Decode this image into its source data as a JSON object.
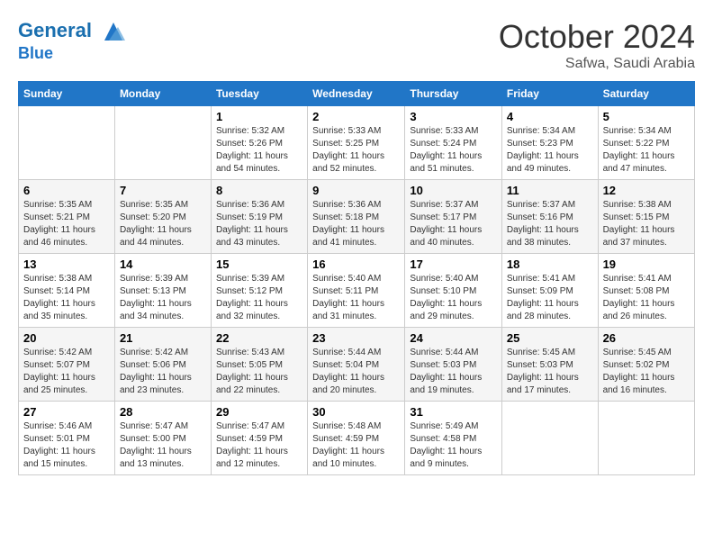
{
  "header": {
    "logo_line1": "General",
    "logo_line2": "Blue",
    "month": "October 2024",
    "location": "Safwa, Saudi Arabia"
  },
  "weekdays": [
    "Sunday",
    "Monday",
    "Tuesday",
    "Wednesday",
    "Thursday",
    "Friday",
    "Saturday"
  ],
  "weeks": [
    [
      {
        "day": "",
        "sunrise": "",
        "sunset": "",
        "daylight": ""
      },
      {
        "day": "",
        "sunrise": "",
        "sunset": "",
        "daylight": ""
      },
      {
        "day": "1",
        "sunrise": "Sunrise: 5:32 AM",
        "sunset": "Sunset: 5:26 PM",
        "daylight": "Daylight: 11 hours and 54 minutes."
      },
      {
        "day": "2",
        "sunrise": "Sunrise: 5:33 AM",
        "sunset": "Sunset: 5:25 PM",
        "daylight": "Daylight: 11 hours and 52 minutes."
      },
      {
        "day": "3",
        "sunrise": "Sunrise: 5:33 AM",
        "sunset": "Sunset: 5:24 PM",
        "daylight": "Daylight: 11 hours and 51 minutes."
      },
      {
        "day": "4",
        "sunrise": "Sunrise: 5:34 AM",
        "sunset": "Sunset: 5:23 PM",
        "daylight": "Daylight: 11 hours and 49 minutes."
      },
      {
        "day": "5",
        "sunrise": "Sunrise: 5:34 AM",
        "sunset": "Sunset: 5:22 PM",
        "daylight": "Daylight: 11 hours and 47 minutes."
      }
    ],
    [
      {
        "day": "6",
        "sunrise": "Sunrise: 5:35 AM",
        "sunset": "Sunset: 5:21 PM",
        "daylight": "Daylight: 11 hours and 46 minutes."
      },
      {
        "day": "7",
        "sunrise": "Sunrise: 5:35 AM",
        "sunset": "Sunset: 5:20 PM",
        "daylight": "Daylight: 11 hours and 44 minutes."
      },
      {
        "day": "8",
        "sunrise": "Sunrise: 5:36 AM",
        "sunset": "Sunset: 5:19 PM",
        "daylight": "Daylight: 11 hours and 43 minutes."
      },
      {
        "day": "9",
        "sunrise": "Sunrise: 5:36 AM",
        "sunset": "Sunset: 5:18 PM",
        "daylight": "Daylight: 11 hours and 41 minutes."
      },
      {
        "day": "10",
        "sunrise": "Sunrise: 5:37 AM",
        "sunset": "Sunset: 5:17 PM",
        "daylight": "Daylight: 11 hours and 40 minutes."
      },
      {
        "day": "11",
        "sunrise": "Sunrise: 5:37 AM",
        "sunset": "Sunset: 5:16 PM",
        "daylight": "Daylight: 11 hours and 38 minutes."
      },
      {
        "day": "12",
        "sunrise": "Sunrise: 5:38 AM",
        "sunset": "Sunset: 5:15 PM",
        "daylight": "Daylight: 11 hours and 37 minutes."
      }
    ],
    [
      {
        "day": "13",
        "sunrise": "Sunrise: 5:38 AM",
        "sunset": "Sunset: 5:14 PM",
        "daylight": "Daylight: 11 hours and 35 minutes."
      },
      {
        "day": "14",
        "sunrise": "Sunrise: 5:39 AM",
        "sunset": "Sunset: 5:13 PM",
        "daylight": "Daylight: 11 hours and 34 minutes."
      },
      {
        "day": "15",
        "sunrise": "Sunrise: 5:39 AM",
        "sunset": "Sunset: 5:12 PM",
        "daylight": "Daylight: 11 hours and 32 minutes."
      },
      {
        "day": "16",
        "sunrise": "Sunrise: 5:40 AM",
        "sunset": "Sunset: 5:11 PM",
        "daylight": "Daylight: 11 hours and 31 minutes."
      },
      {
        "day": "17",
        "sunrise": "Sunrise: 5:40 AM",
        "sunset": "Sunset: 5:10 PM",
        "daylight": "Daylight: 11 hours and 29 minutes."
      },
      {
        "day": "18",
        "sunrise": "Sunrise: 5:41 AM",
        "sunset": "Sunset: 5:09 PM",
        "daylight": "Daylight: 11 hours and 28 minutes."
      },
      {
        "day": "19",
        "sunrise": "Sunrise: 5:41 AM",
        "sunset": "Sunset: 5:08 PM",
        "daylight": "Daylight: 11 hours and 26 minutes."
      }
    ],
    [
      {
        "day": "20",
        "sunrise": "Sunrise: 5:42 AM",
        "sunset": "Sunset: 5:07 PM",
        "daylight": "Daylight: 11 hours and 25 minutes."
      },
      {
        "day": "21",
        "sunrise": "Sunrise: 5:42 AM",
        "sunset": "Sunset: 5:06 PM",
        "daylight": "Daylight: 11 hours and 23 minutes."
      },
      {
        "day": "22",
        "sunrise": "Sunrise: 5:43 AM",
        "sunset": "Sunset: 5:05 PM",
        "daylight": "Daylight: 11 hours and 22 minutes."
      },
      {
        "day": "23",
        "sunrise": "Sunrise: 5:44 AM",
        "sunset": "Sunset: 5:04 PM",
        "daylight": "Daylight: 11 hours and 20 minutes."
      },
      {
        "day": "24",
        "sunrise": "Sunrise: 5:44 AM",
        "sunset": "Sunset: 5:03 PM",
        "daylight": "Daylight: 11 hours and 19 minutes."
      },
      {
        "day": "25",
        "sunrise": "Sunrise: 5:45 AM",
        "sunset": "Sunset: 5:03 PM",
        "daylight": "Daylight: 11 hours and 17 minutes."
      },
      {
        "day": "26",
        "sunrise": "Sunrise: 5:45 AM",
        "sunset": "Sunset: 5:02 PM",
        "daylight": "Daylight: 11 hours and 16 minutes."
      }
    ],
    [
      {
        "day": "27",
        "sunrise": "Sunrise: 5:46 AM",
        "sunset": "Sunset: 5:01 PM",
        "daylight": "Daylight: 11 hours and 15 minutes."
      },
      {
        "day": "28",
        "sunrise": "Sunrise: 5:47 AM",
        "sunset": "Sunset: 5:00 PM",
        "daylight": "Daylight: 11 hours and 13 minutes."
      },
      {
        "day": "29",
        "sunrise": "Sunrise: 5:47 AM",
        "sunset": "Sunset: 4:59 PM",
        "daylight": "Daylight: 11 hours and 12 minutes."
      },
      {
        "day": "30",
        "sunrise": "Sunrise: 5:48 AM",
        "sunset": "Sunset: 4:59 PM",
        "daylight": "Daylight: 11 hours and 10 minutes."
      },
      {
        "day": "31",
        "sunrise": "Sunrise: 5:49 AM",
        "sunset": "Sunset: 4:58 PM",
        "daylight": "Daylight: 11 hours and 9 minutes."
      },
      {
        "day": "",
        "sunrise": "",
        "sunset": "",
        "daylight": ""
      },
      {
        "day": "",
        "sunrise": "",
        "sunset": "",
        "daylight": ""
      }
    ]
  ]
}
